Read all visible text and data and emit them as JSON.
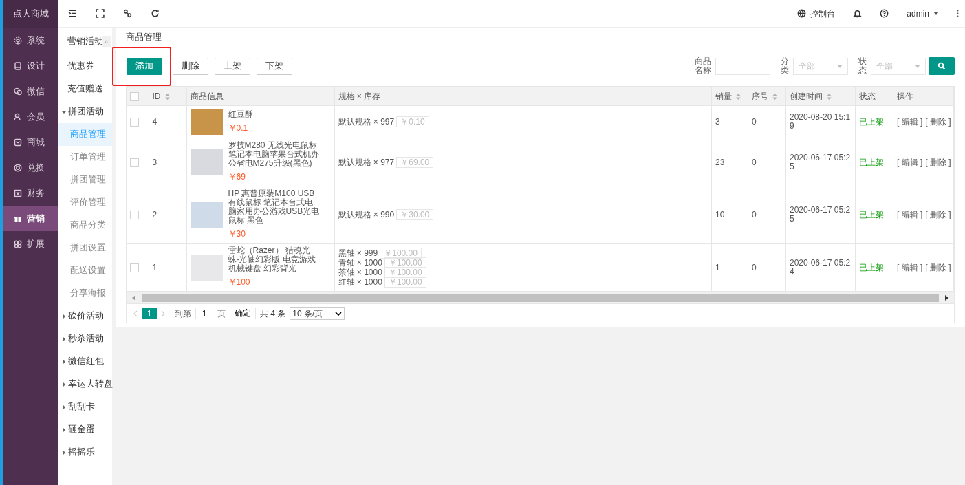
{
  "brand": "点大商城",
  "main_menu": [
    {
      "label": "系统",
      "selected": false
    },
    {
      "label": "设计",
      "selected": false
    },
    {
      "label": "微信",
      "selected": false
    },
    {
      "label": "会员",
      "selected": false
    },
    {
      "label": "商城",
      "selected": false
    },
    {
      "label": "兑换",
      "selected": false
    },
    {
      "label": "财务",
      "selected": false
    },
    {
      "label": "营销",
      "selected": true
    },
    {
      "label": "扩展",
      "selected": false
    }
  ],
  "topbar": {
    "console": "控制台",
    "user": "admin"
  },
  "submenu": {
    "title": "营销活动",
    "collapse_glyph": "«",
    "items": [
      {
        "label": "优惠券",
        "kind": "link"
      },
      {
        "label": "充值赠送",
        "kind": "link"
      },
      {
        "label": "拼团活动",
        "kind": "group",
        "expanded": true,
        "children": [
          {
            "label": "商品管理",
            "selected": true
          },
          {
            "label": "订单管理",
            "selected": false
          },
          {
            "label": "拼团管理",
            "selected": false
          },
          {
            "label": "评价管理",
            "selected": false
          },
          {
            "label": "商品分类",
            "selected": false
          },
          {
            "label": "拼团设置",
            "selected": false
          },
          {
            "label": "配送设置",
            "selected": false
          },
          {
            "label": "分享海报",
            "selected": false
          }
        ]
      },
      {
        "label": "砍价活动",
        "kind": "group",
        "expanded": false
      },
      {
        "label": "秒杀活动",
        "kind": "group",
        "expanded": false
      },
      {
        "label": "微信红包",
        "kind": "group",
        "expanded": false
      },
      {
        "label": "幸运大转盘",
        "kind": "group",
        "expanded": false
      },
      {
        "label": "刮刮卡",
        "kind": "group",
        "expanded": false
      },
      {
        "label": "砸金蛋",
        "kind": "group",
        "expanded": false
      },
      {
        "label": "摇摇乐",
        "kind": "group",
        "expanded": false
      }
    ]
  },
  "page_title": "商品管理",
  "actions": [
    {
      "label": "添加",
      "kind": "primary",
      "highlighted": true
    },
    {
      "label": "删除",
      "kind": "plain",
      "highlighted": false
    },
    {
      "label": "上架",
      "kind": "plain",
      "highlighted": false
    },
    {
      "label": "下架",
      "kind": "plain",
      "highlighted": false
    }
  ],
  "filters": [
    {
      "label": "商品名称",
      "kind": "text"
    },
    {
      "label": "分类",
      "kind": "select",
      "placeholder": "全部"
    },
    {
      "label": "状态",
      "kind": "select",
      "placeholder": "全部"
    }
  ],
  "table": {
    "header_checked": false,
    "columns": [
      {
        "label": "ID",
        "sortable": true
      },
      {
        "label": "商品信息",
        "sortable": false
      },
      {
        "label": "规格 × 库存",
        "sortable": false
      },
      {
        "label": "销量",
        "sortable": true
      },
      {
        "label": "序号",
        "sortable": true
      },
      {
        "label": "创建时间",
        "sortable": true
      },
      {
        "label": "状态",
        "sortable": false
      },
      {
        "label": "操作",
        "sortable": false
      }
    ],
    "rows": [
      {
        "checked": false,
        "id": "4",
        "name": "红豆酥",
        "price": "￥0.1",
        "specs": [
          {
            "text": "默认规格 × 997",
            "price": "￥0.10"
          }
        ],
        "sales": "3",
        "order": "0",
        "created": "2020-08-20 15:19",
        "status": "已上架",
        "actions": [
          "[ 编辑 ]",
          "[ 删除 ]"
        ]
      },
      {
        "checked": false,
        "id": "3",
        "name": "罗技M280 无线光电鼠标笔记本电脑苹果台式机办公省电M275升级(黑色)",
        "price": "￥69",
        "specs": [
          {
            "text": "默认规格 × 977",
            "price": "￥69.00"
          }
        ],
        "sales": "23",
        "order": "0",
        "created": "2020-06-17 05:25",
        "status": "已上架",
        "actions": [
          "[ 编辑 ]",
          "[ 删除 ]"
        ]
      },
      {
        "checked": false,
        "id": "2",
        "name": "HP 惠普原装M100 USB有线鼠标 笔记本台式电脑家用办公游戏USB光电鼠标 黑色",
        "price": "￥30",
        "specs": [
          {
            "text": "默认规格 × 990",
            "price": "￥30.00"
          }
        ],
        "sales": "10",
        "order": "0",
        "created": "2020-06-17 05:25",
        "status": "已上架",
        "actions": [
          "[ 编辑 ]",
          "[ 删除 ]"
        ]
      },
      {
        "checked": false,
        "id": "1",
        "name": "雷蛇（Razer） 猎魂光蛛-光轴幻彩版 电竞游戏机械键盘 幻彩背光",
        "price": "￥100",
        "specs": [
          {
            "text": "黑轴 × 999",
            "price": "￥100.00"
          },
          {
            "text": "青轴 × 1000",
            "price": "￥100.00"
          },
          {
            "text": "茶轴 × 1000",
            "price": "￥100.00"
          },
          {
            "text": "红轴 × 1000",
            "price": "￥100.00"
          }
        ],
        "sales": "1",
        "order": "0",
        "created": "2020-06-17 05:24",
        "status": "已上架",
        "actions": [
          "[ 编辑 ]",
          "[ 删除 ]"
        ]
      }
    ]
  },
  "pagination": {
    "pages": [
      {
        "label": "1",
        "selected": true
      }
    ],
    "goto_label": "到第",
    "goto_value": "1",
    "page_unit": "页",
    "confirm": "确定",
    "total": "共 4 条",
    "page_size": "10 条/页"
  }
}
